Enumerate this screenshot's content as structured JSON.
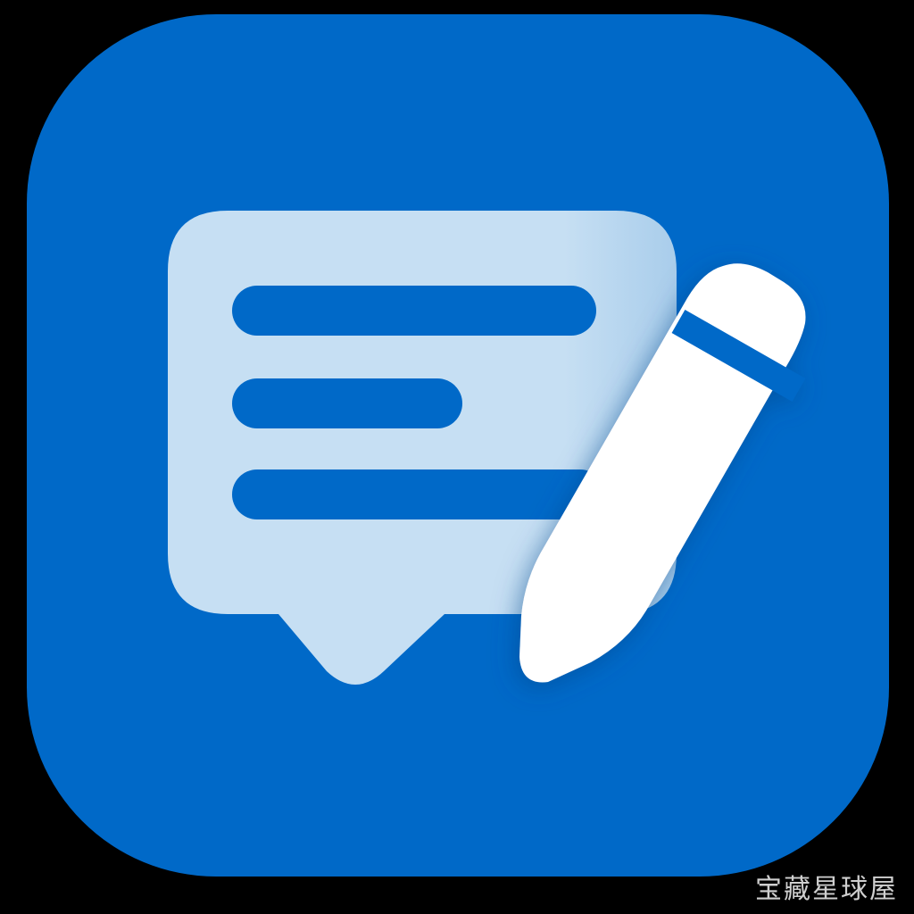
{
  "icon": {
    "name": "notes-chat-edit-app-icon",
    "glyphs": [
      "speech-bubble-icon",
      "pencil-icon"
    ],
    "colors": {
      "background": "#000000",
      "tile": "#0069C8",
      "tile_shadow": "#00478C",
      "bubble": "#C6DFF3",
      "bubble_lines": "#0069C8",
      "pencil": "#FFFFFF",
      "pencil_band": "#0069C8"
    }
  },
  "watermark": {
    "text": "宝藏星球屋"
  }
}
